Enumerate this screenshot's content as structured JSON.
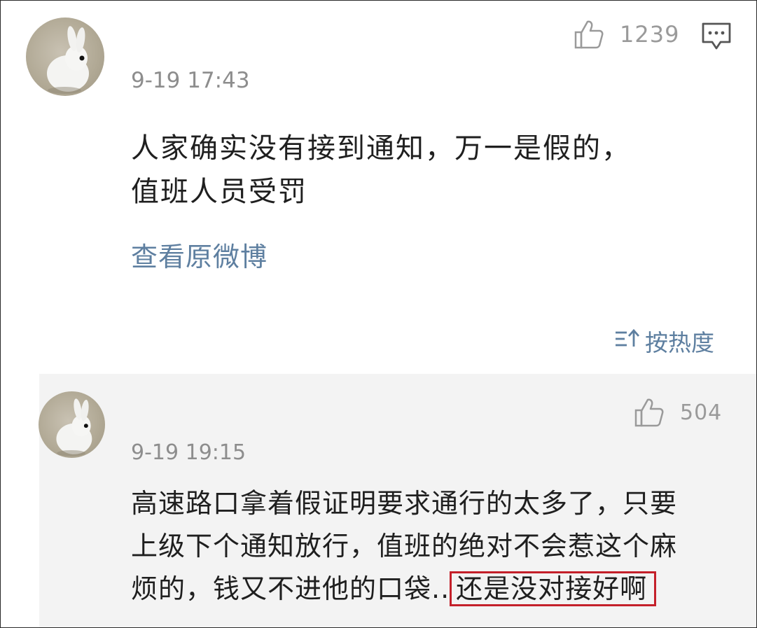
{
  "comments": [
    {
      "likes": "1239",
      "time": "9-19 17:43",
      "text_line1": "人家确实没有接到通知，万一是假的，",
      "text_line2": "值班人员受罚",
      "link": "查看原微博"
    },
    {
      "likes": "504",
      "time": "9-19 19:15",
      "text_line1": "高速路口拿着假证明要求通行的太多了，只要",
      "text_line2": "上级下个通知放行，值班的绝对不会惹这个麻",
      "text_line3_plain": "烦的，钱又不进他的口袋..",
      "text_line3_highlight": "还是没对接好啊"
    }
  ],
  "sort": {
    "label": "按热度"
  },
  "icons": {
    "like": "thumbs-up-icon",
    "reply": "comment-icon",
    "sort": "sort-icon",
    "avatar": "rabbit-avatar"
  },
  "colors": {
    "link": "#5e7fa0",
    "highlight_border": "#c4202a",
    "gray_bg": "#f3f3f3"
  }
}
